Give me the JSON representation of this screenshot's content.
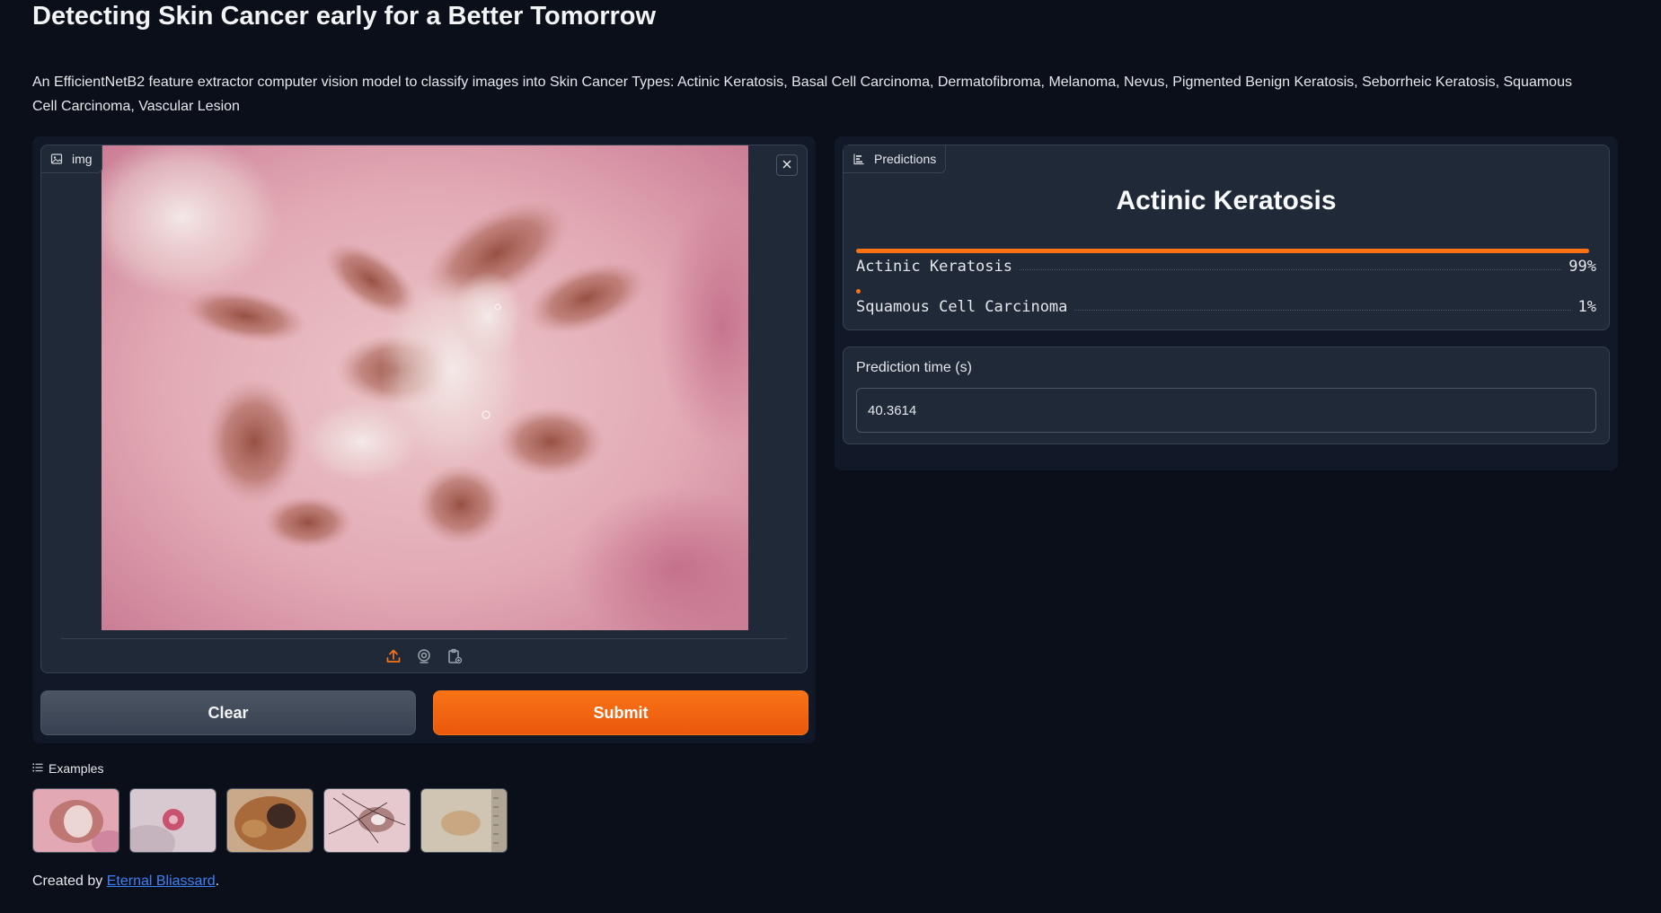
{
  "title": "Detecting Skin Cancer early for a Better Tomorrow",
  "description": "An EfficientNetB2 feature extractor computer vision model to classify images into Skin Cancer Types: Actinic Keratosis, Basal Cell Carcinoma, Dermatofibroma, Melanoma, Nevus, Pigmented Benign Keratosis, Seborrheic Keratosis, Squamous Cell Carcinoma, Vascular Lesion",
  "image_input": {
    "label": "img",
    "label_icon": "image-icon",
    "close_icon": "close-icon",
    "sources": [
      "upload-icon",
      "webcam-icon",
      "clipboard-icon"
    ]
  },
  "buttons": {
    "clear_label": "Clear",
    "submit_label": "Submit"
  },
  "predictions": {
    "label": "Predictions",
    "label_icon": "bar-chart-icon",
    "top_label": "Actinic Keratosis",
    "confidences": [
      {
        "name": "Actinic Keratosis",
        "percent_text": "99%",
        "value": 0.99
      },
      {
        "name": "Squamous Cell Carcinoma",
        "percent_text": "1%",
        "value": 0.01
      }
    ]
  },
  "prediction_time": {
    "label": "Prediction time (s)",
    "value": "40.3614"
  },
  "examples": {
    "label": "Examples",
    "label_icon": "list-icon",
    "count": 5
  },
  "footer": {
    "prefix": "Created by ",
    "link_text": "Eternal Bliassard",
    "suffix": "."
  },
  "colors": {
    "background": "#0b0f19",
    "panel": "#111827",
    "block": "#1f2937",
    "accent": "#f97316",
    "link": "#3b82f6"
  }
}
